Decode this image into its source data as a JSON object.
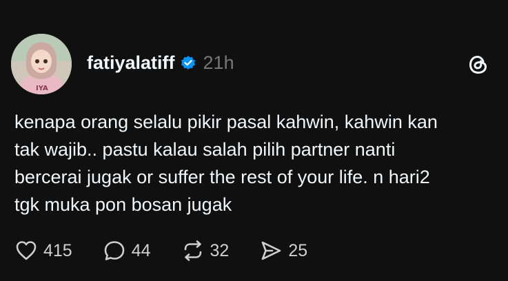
{
  "post": {
    "username": "fatiyalatiff",
    "time": "21h",
    "lines": [
      "kenapa orang selalu pikir pasal kahwin, kahwin kan",
      "tak wajib.. pastu kalau salah pilih partner nanti",
      "bercerai jugak or suffer the rest of your life. n hari2",
      "tgk muka pon bosan jugak"
    ]
  },
  "actions": {
    "likes": "415",
    "replies": "44",
    "reposts": "32",
    "shares": "25"
  },
  "icons": {
    "verified": "verified-badge-icon",
    "threads": "threads-logo-icon",
    "like": "heart-icon",
    "reply": "comment-icon",
    "repost": "repost-icon",
    "share": "send-icon"
  },
  "colors": {
    "background": "#101010",
    "text": "#f3f5f7",
    "muted": "#777777",
    "verified": "#0095f6"
  }
}
